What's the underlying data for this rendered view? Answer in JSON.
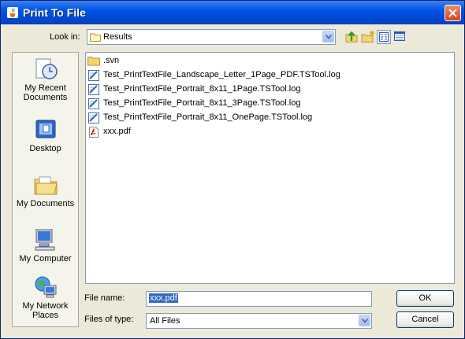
{
  "window": {
    "title": "Print To File"
  },
  "look_in": {
    "label": "Look in:",
    "value": "Results"
  },
  "sidebar": {
    "items": [
      {
        "label1": "My Recent",
        "label2": "Documents"
      },
      {
        "label1": "Desktop",
        "label2": ""
      },
      {
        "label1": "My Documents",
        "label2": ""
      },
      {
        "label1": "My Computer",
        "label2": ""
      },
      {
        "label1": "My Network",
        "label2": "Places"
      }
    ]
  },
  "files": [
    {
      "name": ".svn",
      "icon": "folder-icon"
    },
    {
      "name": "Test_PrintTextFile_Landscape_Letter_1Page_PDF.TSTool.log",
      "icon": "log-file-icon"
    },
    {
      "name": "Test_PrintTextFile_Portrait_8x11_1Page.TSTool.log",
      "icon": "log-file-icon"
    },
    {
      "name": "Test_PrintTextFile_Portrait_8x11_3Page.TSTool.log",
      "icon": "log-file-icon"
    },
    {
      "name": "Test_PrintTextFile_Portrait_8x11_OnePage.TSTool.log",
      "icon": "log-file-icon"
    },
    {
      "name": "xxx.pdf",
      "icon": "pdf-file-icon"
    }
  ],
  "file_name": {
    "label": "File name:",
    "value": "xxx.pdf"
  },
  "file_type": {
    "label": "Files of type:",
    "value": "All Files"
  },
  "buttons": {
    "ok": "OK",
    "cancel": "Cancel"
  }
}
